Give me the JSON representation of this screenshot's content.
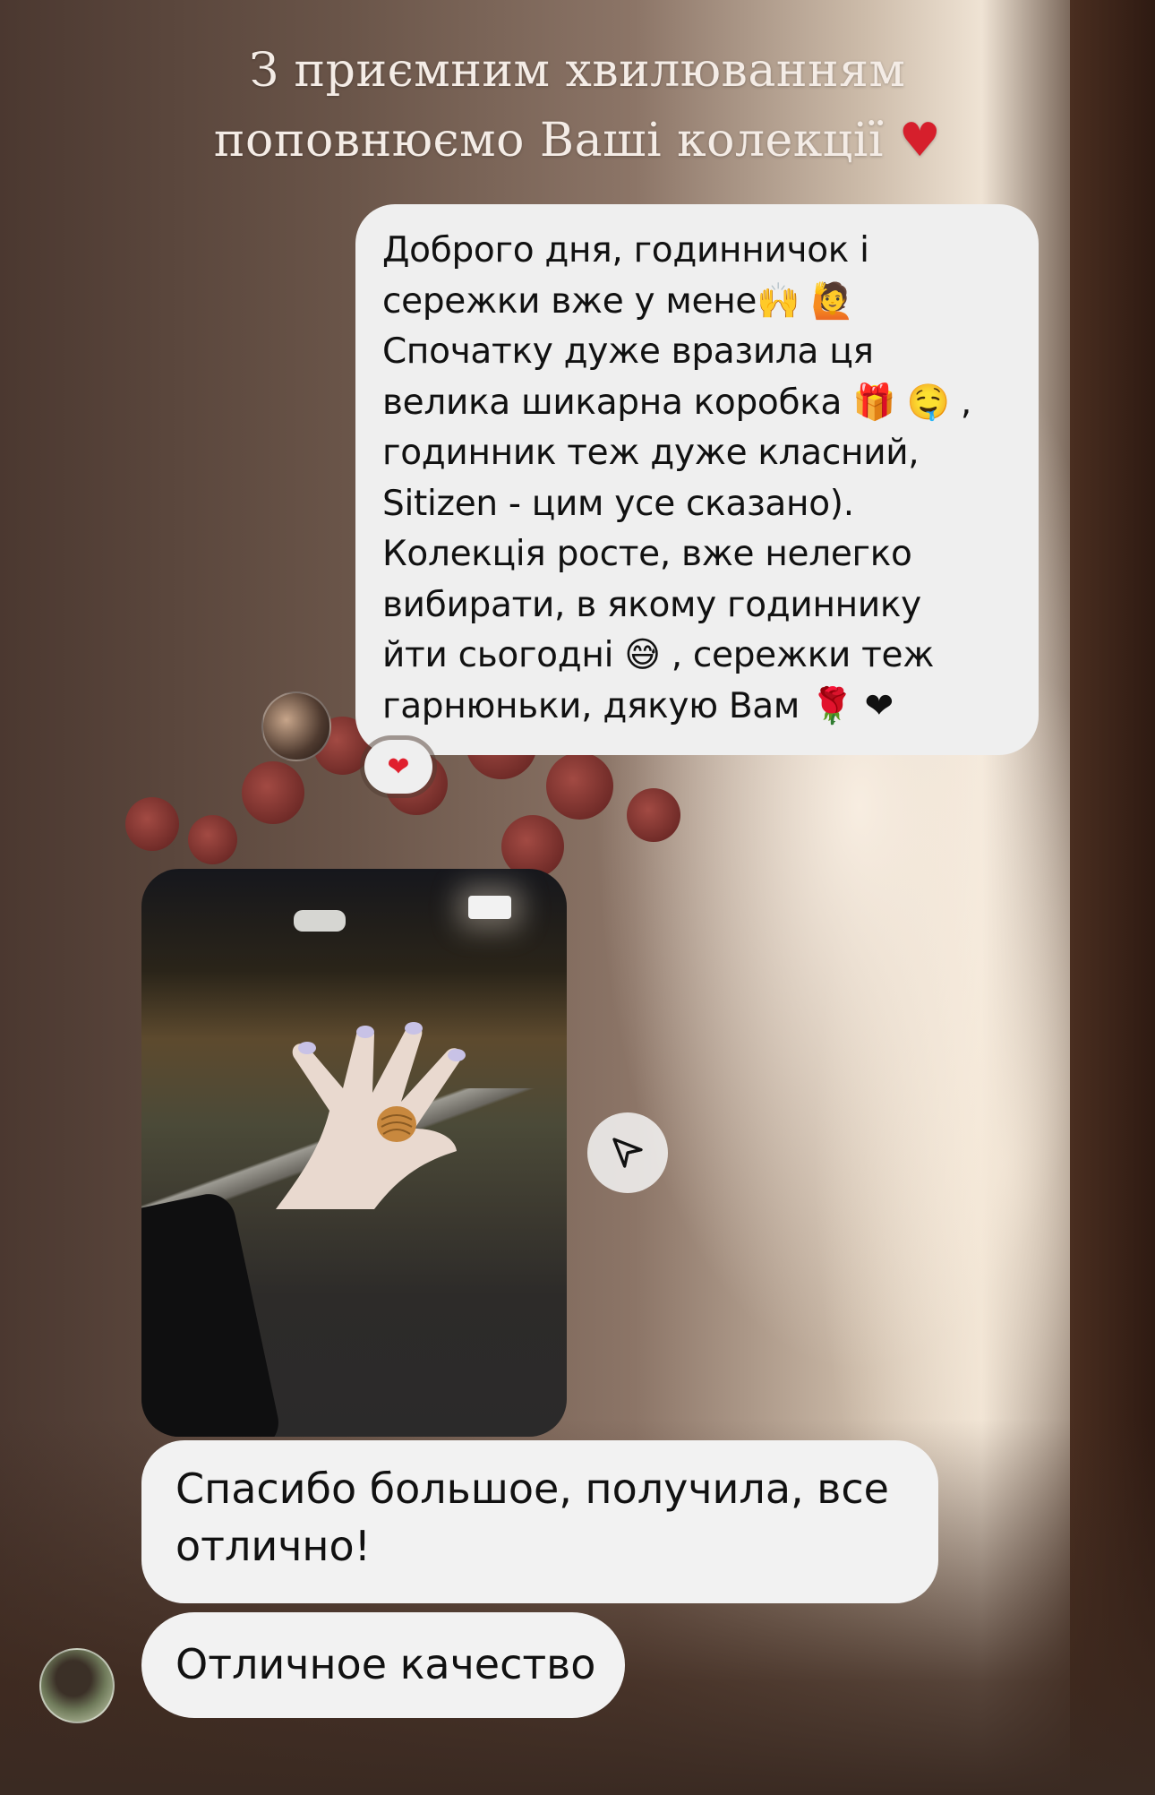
{
  "header": {
    "line1": "З приємним хвилюванням",
    "line2": "поповнюємо Ваші колекції",
    "heart": "♥"
  },
  "messages": {
    "first": {
      "text": "Доброго дня, годинничок і\nсережки вже у мене🙌 🙋\nСпочатку дуже вразила ця\nвелика шикарна коробка 🎁 🤤 ,\nгодинник теж дуже класний,\nSitizen - цим усе сказано).\nКолекція росте, вже нелегко\nвибирати, в якому годиннику\nйти сьогодні 😅 , сережки теж\nгарнюньки, дякую Вам 🌹 ❤",
      "reaction": "❤"
    },
    "second": {
      "text": "Спасибо большое, получила, все\nотлично!"
    },
    "third": {
      "text": "Отличное качество"
    }
  },
  "icons": {
    "send": "send-icon",
    "avatar_top": "user-avatar",
    "avatar_bottom": "user-avatar"
  },
  "colors": {
    "bubble": "#efefef",
    "heart": "#d61f2c",
    "header_text": "#f4ece6"
  }
}
